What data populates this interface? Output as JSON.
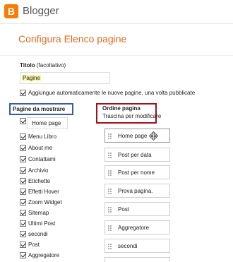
{
  "header": {
    "logo_glyph": "B",
    "brand": "Blogger"
  },
  "page_title": "Configura Elenco pagine",
  "titolo": {
    "label": "Titolo",
    "hint": "(facoltativo)",
    "value": "Pagine"
  },
  "auto_add_label": "Aggiungue automaticamente le nuove pagine, una volta pubblicate",
  "pagine_da_mostrare": {
    "label": "Pagine da mostrare",
    "homepage_label": "Home page",
    "items": [
      "Menu Libro",
      "About me",
      "Contattami",
      "Archivio",
      "Etichette",
      "Effetti Hover",
      "Zoom Widget",
      "Sitemap",
      "Ultimi Post",
      "secondi",
      "Post",
      "Aggregatore"
    ]
  },
  "ordine_pagina": {
    "title": "Ordine pagina",
    "subtitle": "Trascina per modificare",
    "items": [
      "Home page",
      "Post per data",
      "Post per nome",
      "Prova pagina.",
      "Post",
      "Aggregatore",
      "secondi"
    ]
  },
  "icons": {
    "logo": "blogger-logo-icon",
    "checkbox": "checkmark-icon",
    "grip": "drag-grip-icon",
    "move": "move-cursor-icon"
  },
  "colors": {
    "brand_orange": "#f57d00",
    "title_orange": "#dd6b1f",
    "highlight_yellow": "#fbf7a4",
    "annotation_blue": "#3a5ca0",
    "annotation_red": "#a0101a"
  }
}
